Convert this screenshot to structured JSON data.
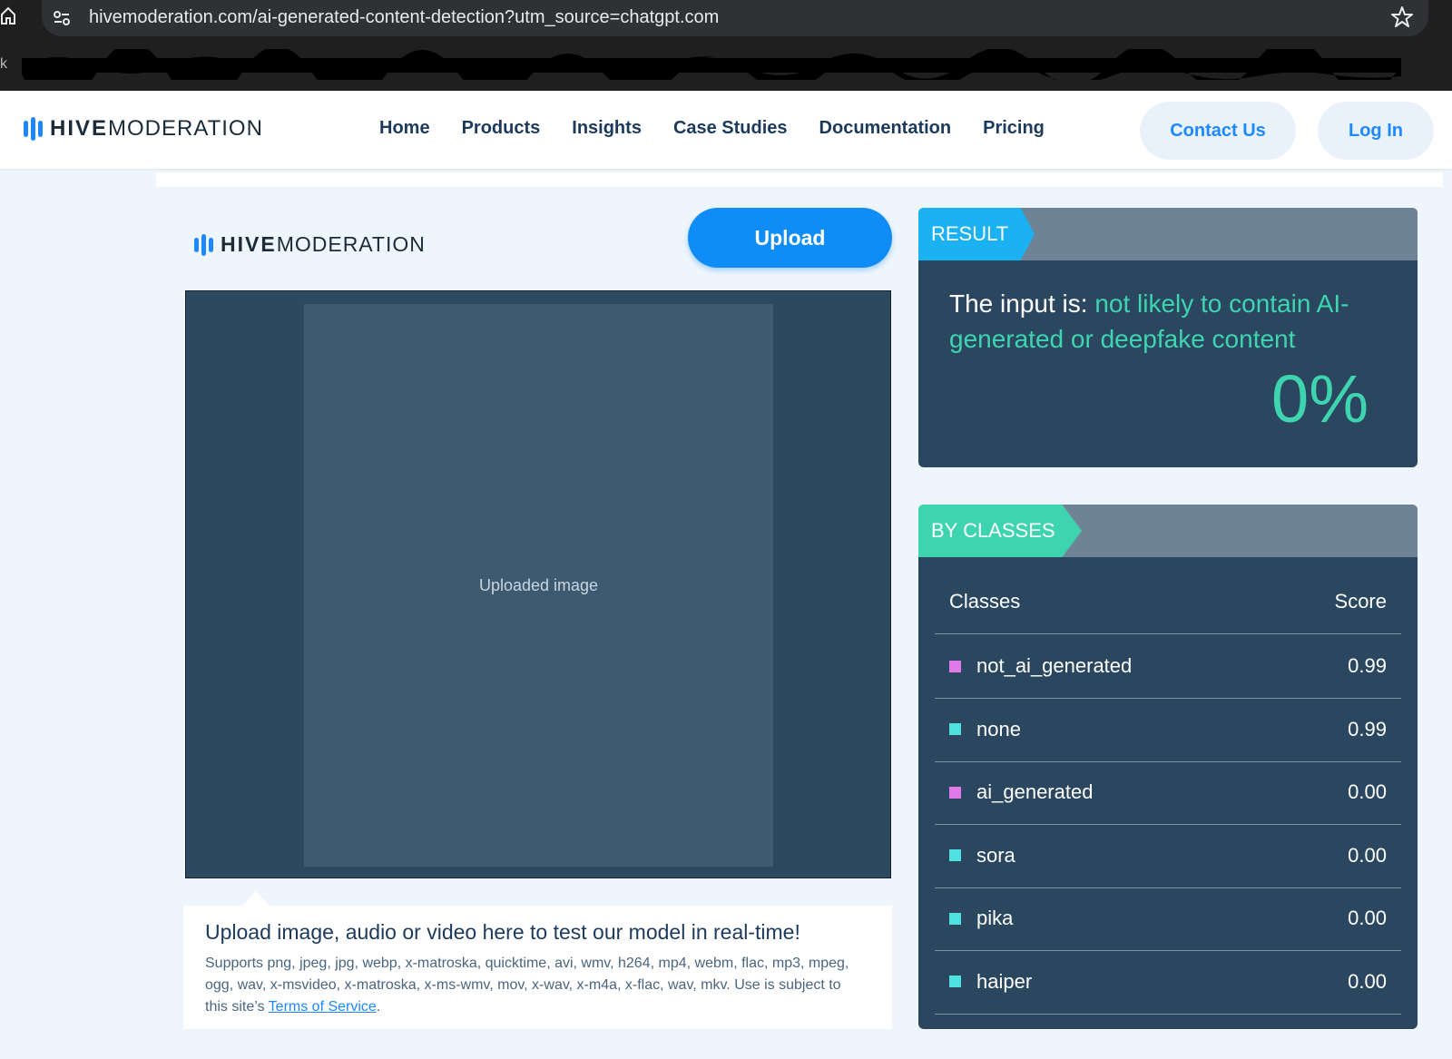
{
  "browser": {
    "url": "hivemoderation.com/ai-generated-content-detection?utm_source=chatgpt.com",
    "bookmark_glyph": "k"
  },
  "header": {
    "logo_hive": "HIVE",
    "logo_moderation": "MODERATION",
    "nav": [
      "Home",
      "Products",
      "Insights",
      "Case Studies",
      "Documentation",
      "Pricing"
    ],
    "contact_label": "Contact Us",
    "login_label": "Log In"
  },
  "demo": {
    "logo_hive": "HIVE",
    "logo_moderation": "MODERATION",
    "upload_label": "Upload",
    "preview_placeholder": "Uploaded image",
    "info_title": "Upload image, audio or video here to test our model in real-time!",
    "info_text": "Supports png, jpeg, jpg, webp, x-matroska, quicktime, avi, wmv, h264, mp4, webm, flac, mp3, mpeg, ogg, wav, x-msvideo, x-matroska, x-ms-wmv, mov, x-wav, x-m4a, x-flac, wav, mkv. Use is subject to this site’s ",
    "tos_label": "Terms of Service",
    "info_end": "."
  },
  "result": {
    "tab_label": "RESULT",
    "prefix": "The input is: ",
    "verdict": "not likely to contain AI-generated or deepfake content",
    "percent": "0%"
  },
  "classes": {
    "tab_label": "BY CLASSES",
    "col_class": "Classes",
    "col_score": "Score",
    "rows": [
      {
        "name": "not_ai_generated",
        "score": "0.99",
        "color": "#e07ae8"
      },
      {
        "name": "none",
        "score": "0.99",
        "color": "#4fe0e0"
      },
      {
        "name": "ai_generated",
        "score": "0.00",
        "color": "#e07ae8"
      },
      {
        "name": "sora",
        "score": "0.00",
        "color": "#4fe0e0"
      },
      {
        "name": "pika",
        "score": "0.00",
        "color": "#4fe0e0"
      },
      {
        "name": "haiper",
        "score": "0.00",
        "color": "#4fe0e0"
      }
    ]
  },
  "colors": {
    "accent": "#1e88ff",
    "upload": "#0f8cf6",
    "teal": "#3fd4b0",
    "panel": "#2a475f"
  }
}
